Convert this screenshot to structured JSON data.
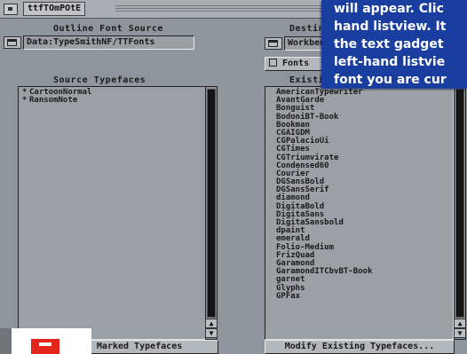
{
  "window": {
    "title": "ttfTOmPOtE"
  },
  "left_panel": {
    "source_label": "Outline Font Source",
    "source_path": "Data:TypeSmithNF/TTFonts",
    "list_label": "Source Typefaces",
    "items": [
      {
        "mark": "*",
        "name": "CartoonNormal"
      },
      {
        "mark": "*",
        "name": "RansomNote"
      }
    ],
    "bottom_button": "Convert Marked Typefaces"
  },
  "right_panel": {
    "dest_label": "Destination",
    "dest_path": "Workbench:Fonts",
    "fonts_button": "Fonts",
    "list_label": "Existing Typefaces",
    "items": [
      {
        "mark": "",
        "name": "AmericanTypewriter"
      },
      {
        "mark": "",
        "name": "AvantGarde"
      },
      {
        "mark": "",
        "name": "Bonguist"
      },
      {
        "mark": "",
        "name": "BodoniBT-Book"
      },
      {
        "mark": "",
        "name": "Bookman"
      },
      {
        "mark": "",
        "name": "CGAIGDM"
      },
      {
        "mark": "",
        "name": "CGPalacioUi"
      },
      {
        "mark": "",
        "name": "CGTimes"
      },
      {
        "mark": "",
        "name": "CGTriumvirate"
      },
      {
        "mark": "",
        "name": "Condensed60"
      },
      {
        "mark": "",
        "name": "Courier"
      },
      {
        "mark": "",
        "name": "DGSansBold"
      },
      {
        "mark": "",
        "name": "DGSansSerif"
      },
      {
        "mark": "",
        "name": "diamond"
      },
      {
        "mark": "",
        "name": "DigitaBold"
      },
      {
        "mark": "",
        "name": "DigitaSans"
      },
      {
        "mark": "",
        "name": "DigitaSansbold"
      },
      {
        "mark": "",
        "name": "dpaint"
      },
      {
        "mark": "",
        "name": "emerald"
      },
      {
        "mark": "",
        "name": "Folio-Medium"
      },
      {
        "mark": "",
        "name": "FrizQuad"
      },
      {
        "mark": "",
        "name": "Garamond"
      },
      {
        "mark": "",
        "name": "GaramondITCbvBT-Book"
      },
      {
        "mark": "",
        "name": "garnet"
      },
      {
        "mark": "",
        "name": "Glyphs"
      },
      {
        "mark": "",
        "name": "GPFax"
      }
    ],
    "bottom_button": "Modify Existing Typefaces..."
  },
  "callout": {
    "lines": [
      "will appear. Clic",
      "hand listview. It",
      "the text gadget",
      "left-hand listvie",
      "font you are cur"
    ],
    "color": "#1a3ea0"
  }
}
